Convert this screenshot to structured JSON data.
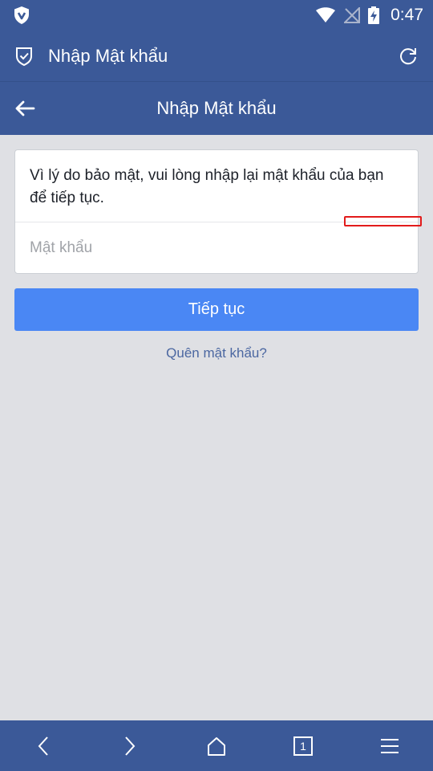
{
  "status_bar": {
    "time": "0:47",
    "icons": [
      "app-shield-icon",
      "wifi-icon",
      "no-signal-icon",
      "battery-charging-icon"
    ]
  },
  "browser_bar": {
    "title": "Nhập Mật khẩu",
    "icons": [
      "shield-check-icon",
      "refresh-icon"
    ]
  },
  "page": {
    "title": "Nhập Mật khẩu",
    "message": "Vì lý do bảo mật, vui lòng nhập lại mật khẩu của bạn để tiếp tục.",
    "password_placeholder": "Mật khẩu",
    "password_value": "",
    "continue_label": "Tiếp tục",
    "forgot_label": "Quên mật khẩu?"
  },
  "bottom_nav": {
    "tab_count": "1",
    "icons": [
      "back-arrow-icon",
      "forward-arrow-icon",
      "home-icon",
      "tabs-icon",
      "menu-icon"
    ]
  },
  "colors": {
    "brand": "#3b5998",
    "button": "#4a87f4",
    "background": "#dfe0e4",
    "link": "#4b67a1"
  }
}
